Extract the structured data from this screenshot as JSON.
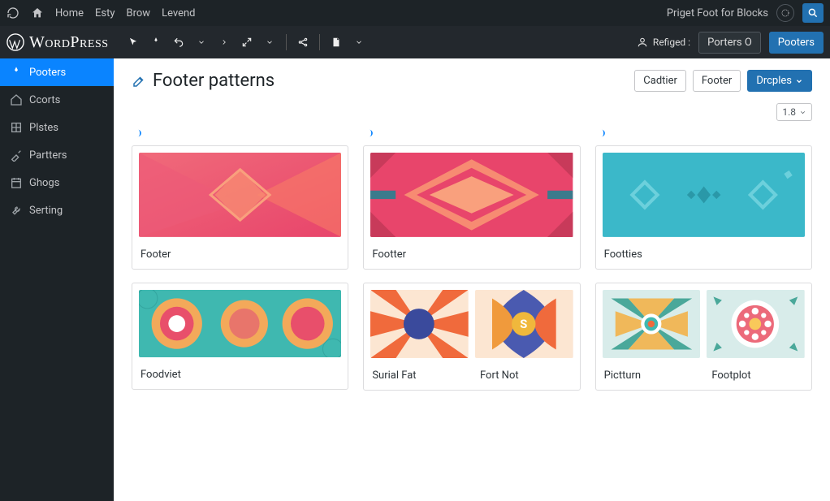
{
  "topbar": {
    "links": [
      "Home",
      "Esty",
      "Brow",
      "Levend"
    ],
    "right_text": "Priget Foot for Blocks"
  },
  "secondbar": {
    "brand": "WordPress",
    "user_label": "Refiged :",
    "pill_label": "Porters O",
    "primary_label": "Pooters"
  },
  "sidebar": {
    "items": [
      {
        "label": "Pooters",
        "active": true
      },
      {
        "label": "Ccorts"
      },
      {
        "label": "Plstes"
      },
      {
        "label": "Partters"
      },
      {
        "label": "Ghogs"
      },
      {
        "label": "Serting"
      }
    ]
  },
  "page": {
    "title": "Footer patterns",
    "actions": {
      "cachier": "Cadtier",
      "footer": "Footer",
      "dropdown": "Drcples"
    },
    "pager": "1.8"
  },
  "patterns": {
    "row1": [
      {
        "label": "Footer"
      },
      {
        "label": "Footter"
      },
      {
        "label": "Footties"
      }
    ],
    "row2": [
      {
        "labels": [
          "Foodviet",
          ""
        ]
      },
      {
        "labels": [
          "Surial Fat",
          "Fort Not"
        ]
      },
      {
        "labels": [
          "Pictturn",
          "Footplot"
        ]
      }
    ]
  }
}
